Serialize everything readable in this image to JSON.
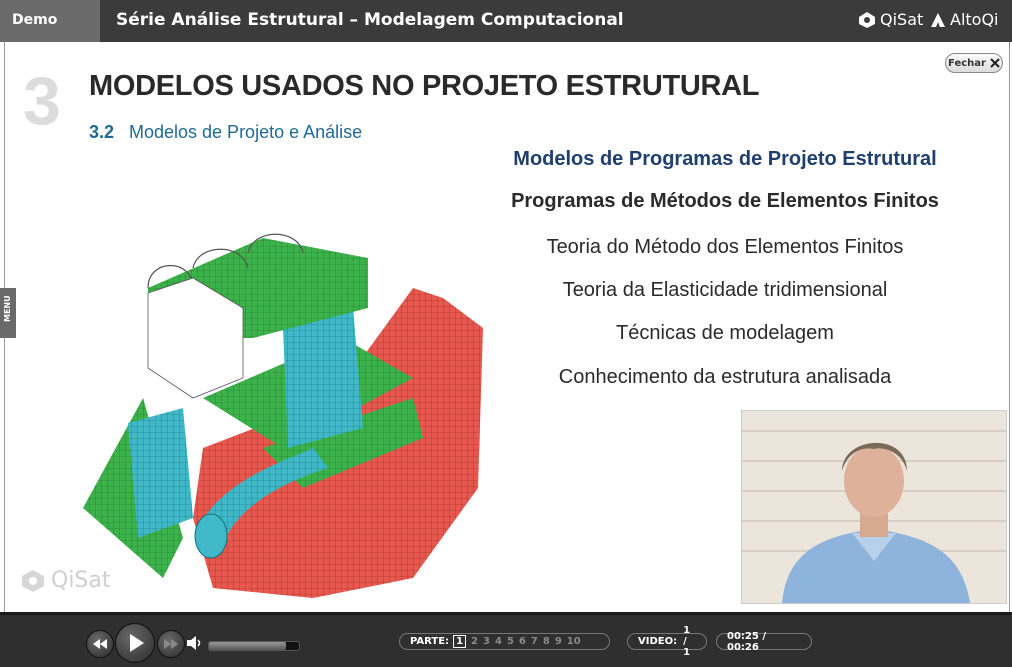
{
  "header": {
    "demo_label": "Demo",
    "course_title": "Série Análise Estrutural – Modelagem Computacional",
    "brand_left": "QiSat",
    "brand_right": "AltoQi"
  },
  "slide": {
    "chapter_number": "3",
    "chapter_title": "MODELOS USADOS NO PROJETO ESTRUTURAL",
    "section_number": "3.2",
    "section_title": "Modelos de Projeto e Análise",
    "close_label": "Fechar",
    "menu_label": "MENU",
    "bullets": [
      "Modelos de Programas de Projeto Estrutural",
      "Programas de Métodos de Elementos Finitos",
      "Teoria do Método dos Elementos Finitos",
      "Teoria da Elasticidade tridimensional",
      "Técnicas de modelagem",
      "Conhecimento da estrutura analisada"
    ],
    "watermark": "QiSat",
    "model_image": "finite-element-structure-model",
    "video_image": "presenter-video"
  },
  "player": {
    "part_label": "PARTE:",
    "current_part": "1",
    "parts": [
      "2",
      "3",
      "4",
      "5",
      "6",
      "7",
      "8",
      "9",
      "10"
    ],
    "video_label": "VIDEO:",
    "video_value": "1 / 1",
    "time": "00:25 / 00:26",
    "volume_fraction": 0.85
  },
  "colors": {
    "top_bar": "#3b3b3b",
    "title_blue": "#1f3f6e",
    "section_blue": "#1f6a94",
    "mesh_green": "#3cb24a",
    "mesh_red": "#e8584f",
    "mesh_cyan": "#3fb8c8"
  }
}
